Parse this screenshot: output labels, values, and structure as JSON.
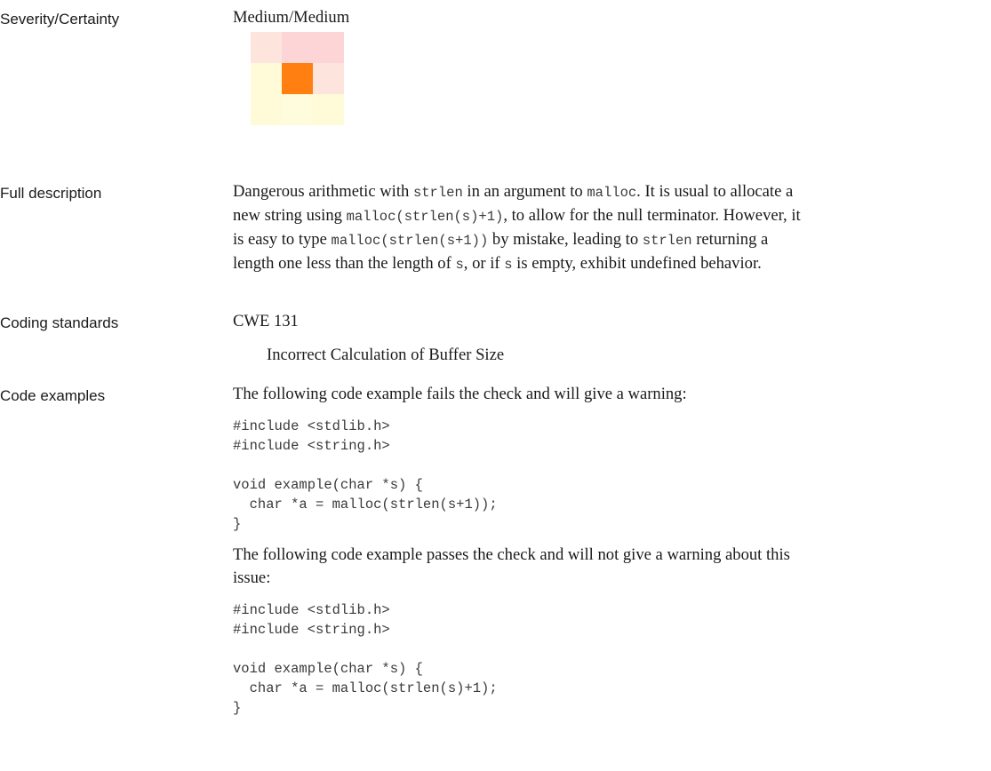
{
  "severity": {
    "label": "Severity/Certainty",
    "value": "Medium/Medium",
    "matrix_colors": [
      [
        "#fde4dc",
        "#fdd5d7",
        "#fdd5d7"
      ],
      [
        "#fffbd8",
        "#ff7f10",
        "#fde4dc"
      ],
      [
        "#fffbd8",
        "#fffcdd",
        "#fffbd8"
      ]
    ],
    "matrix_highlight": {
      "row": 1,
      "col": 1
    }
  },
  "full_description": {
    "label": "Full description",
    "lines": [
      [
        {
          "t": "Dangerous arithmetic with "
        },
        {
          "t": "strlen",
          "code": true
        },
        {
          "t": " in an argument to "
        },
        {
          "t": "malloc",
          "code": true
        },
        {
          "t": ". It is usual to allocate a"
        }
      ],
      [
        {
          "t": "new string using "
        },
        {
          "t": "malloc(strlen(s)+1)",
          "code": true
        },
        {
          "t": ", to allow for the null terminator. However, it"
        }
      ],
      [
        {
          "t": "is easy to type "
        },
        {
          "t": "malloc(strlen(s+1))",
          "code": true
        },
        {
          "t": " by mistake, leading to "
        },
        {
          "t": "strlen",
          "code": true
        },
        {
          "t": " returning a"
        }
      ],
      [
        {
          "t": "length one less than the length of "
        },
        {
          "t": "s",
          "code": true
        },
        {
          "t": ", or if "
        },
        {
          "t": "s",
          "code": true
        },
        {
          "t": " is empty, exhibit undefined behavior."
        }
      ]
    ]
  },
  "coding_standards": {
    "label": "Coding standards",
    "standard": "CWE 131",
    "standard_title": "Incorrect Calculation of Buffer Size"
  },
  "code_examples": {
    "label": "Code examples",
    "fail_intro": "The following code example fails the check and will give a warning:",
    "fail_code": "#include <stdlib.h>\n#include <string.h>\n\nvoid example(char *s) {\n  char *a = malloc(strlen(s+1));\n}",
    "pass_intro_line1": "The following code example passes the check and will not give a warning about this",
    "pass_intro_line2": "issue:",
    "pass_code": "#include <stdlib.h>\n#include <string.h>\n\nvoid example(char *s) {\n  char *a = malloc(strlen(s)+1);\n}"
  }
}
